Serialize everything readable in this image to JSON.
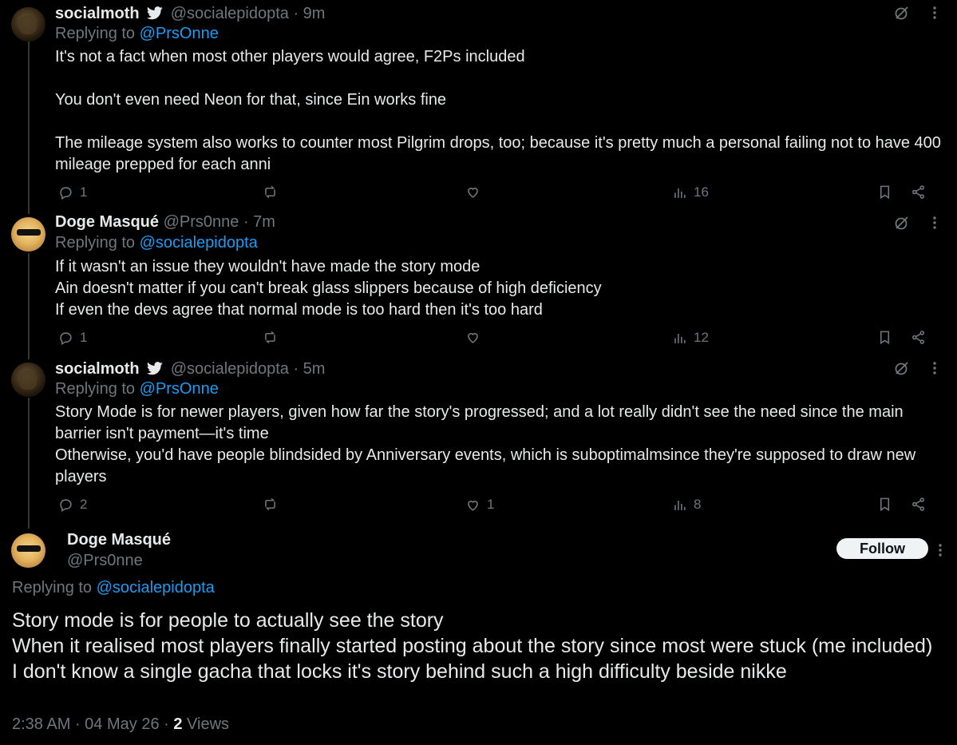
{
  "tweets": [
    {
      "name": "socialmoth",
      "handle": "@socialepidopta",
      "time": "· 9m",
      "replying_prefix": "Replying to",
      "replying_to": "@PrsOnne",
      "lines": [
        "It's not a fact when most other players would agree, F2Ps included",
        "",
        "You don't even need Neon for that, since Ein works fine",
        "",
        "The mileage system also works to counter most Pilgrim drops, too; because it's pretty much a personal failing not to have 400 mileage prepped for each anni"
      ],
      "replies": "1",
      "reposts": "",
      "likes": "",
      "views": "16"
    },
    {
      "name": "Doge Masqué",
      "handle": "@Prs0nne",
      "time": "· 7m",
      "replying_prefix": "Replying to",
      "replying_to": "@socialepidopta",
      "lines": [
        "If it wasn't an issue they wouldn't have made the story mode",
        "Ain doesn't matter if you can't break glass slippers because of high deficiency",
        "If even the devs agree that normal mode is too hard then it's too hard"
      ],
      "replies": "1",
      "reposts": "",
      "likes": "",
      "views": "12"
    },
    {
      "name": "socialmoth",
      "handle": "@socialepidopta",
      "time": "· 5m",
      "replying_prefix": "Replying to",
      "replying_to": "@PrsOnne",
      "lines": [
        "Story Mode is for newer players, given how far the story's progressed; and a lot really didn't see the need since the main barrier isn't payment—it's time",
        "Otherwise, you'd have people blindsided by Anniversary events, which is suboptimalmsince they're supposed to draw new players"
      ],
      "replies": "2",
      "reposts": "",
      "likes": "1",
      "views": "8"
    }
  ],
  "main": {
    "name": "Doge Masqué",
    "handle": "@Prs0nne",
    "follow_label": "Follow",
    "replying_prefix": "Replying to",
    "replying_to": "@socialepidopta",
    "lines": [
      "Story mode is for people to actually see the story",
      "When it realised most players finally started posting about the story since most were stuck (me included)",
      "I don't know a single gacha that locks it's story behind such a high difficulty beside nikke"
    ],
    "time": "2:38 AM",
    "date": "04 May 26",
    "views_count": "2",
    "views_label": "Views"
  }
}
